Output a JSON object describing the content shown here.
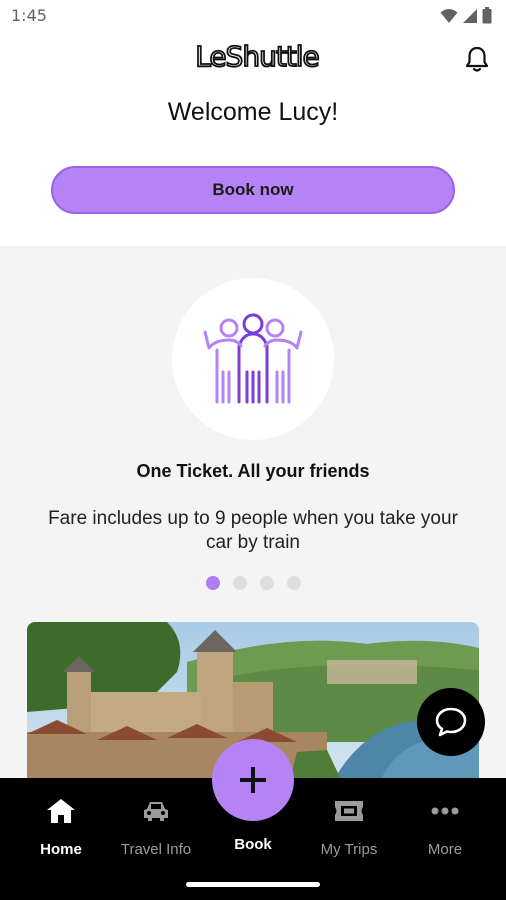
{
  "status_bar": {
    "time": "1:45"
  },
  "header": {
    "logo_text": "LeShuttle",
    "welcome": "Welcome Lucy!",
    "book_now_label": "Book now"
  },
  "promo": {
    "icon": "group-of-friends-icon",
    "title": "One Ticket. All your friends",
    "description": "Fare includes up to 9 people when you take your car by train",
    "carousel": {
      "total": 4,
      "active_index": 0
    }
  },
  "bottom_nav": {
    "items": [
      {
        "label": "Home",
        "icon": "home-icon",
        "active": true
      },
      {
        "label": "Travel Info",
        "icon": "car-icon",
        "active": false
      },
      {
        "label": "Book",
        "icon": "plus-icon",
        "active": false
      },
      {
        "label": "My Trips",
        "icon": "ticket-icon",
        "active": false
      },
      {
        "label": "More",
        "icon": "more-dots-icon",
        "active": false
      }
    ]
  },
  "colors": {
    "accent": "#b583f5",
    "promo_background": "#f4f4f4",
    "nav_background": "#000000"
  }
}
